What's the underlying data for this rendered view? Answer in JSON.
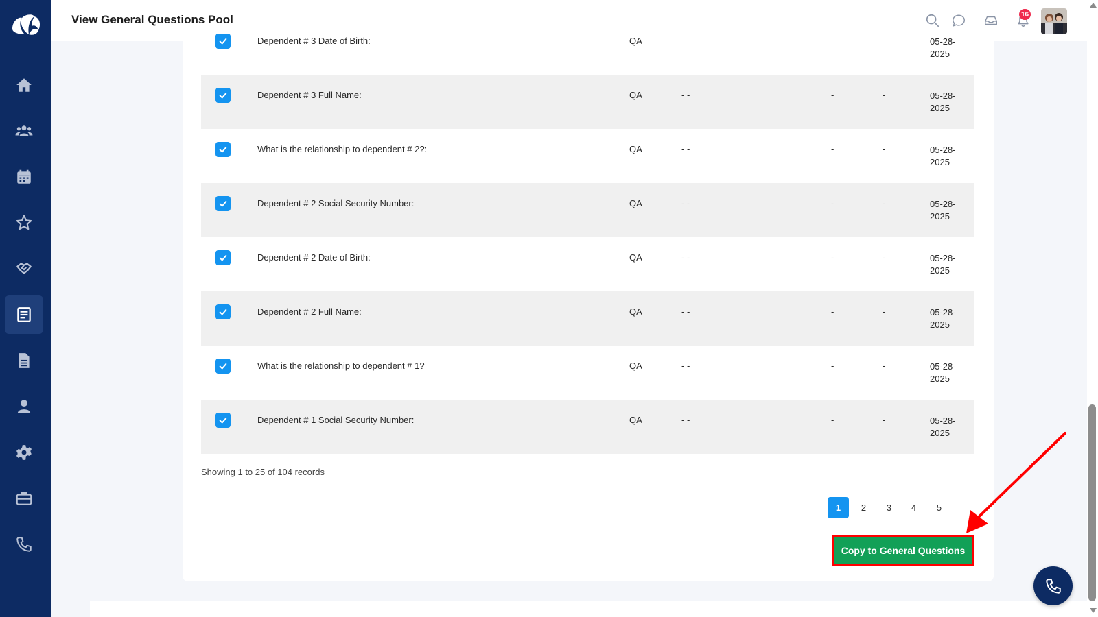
{
  "header": {
    "title": "View General Questions Pool",
    "notification_count": "16"
  },
  "sidebar": {
    "items": [
      {
        "icon": "home-icon"
      },
      {
        "icon": "users-icon"
      },
      {
        "icon": "calendar-icon"
      },
      {
        "icon": "star-icon"
      },
      {
        "icon": "handshake-icon"
      },
      {
        "icon": "questions-icon",
        "active": true
      },
      {
        "icon": "document-icon"
      },
      {
        "icon": "user-icon"
      },
      {
        "icon": "gear-icon"
      },
      {
        "icon": "briefcase-icon"
      },
      {
        "icon": "phone-icon"
      }
    ]
  },
  "table": {
    "partial_row": {
      "question": "Dependent # 3 Date of Birth:",
      "type": "QA",
      "date_line1": "05-28-",
      "date_line2": "2025"
    },
    "rows": [
      {
        "question": "Dependent # 3 Full Name:",
        "type": "QA",
        "options": "- -",
        "col_a": "-",
        "col_b": "-",
        "date_line1": "05-28-",
        "date_line2": "2025"
      },
      {
        "question": "What is the relationship to dependent # 2?:",
        "type": "QA",
        "options": "- -",
        "col_a": "-",
        "col_b": "-",
        "date_line1": "05-28-",
        "date_line2": "2025"
      },
      {
        "question": "Dependent # 2 Social Security Number:",
        "type": "QA",
        "options": "- -",
        "col_a": "-",
        "col_b": "-",
        "date_line1": "05-28-",
        "date_line2": "2025"
      },
      {
        "question": "Dependent # 2 Date of Birth:",
        "type": "QA",
        "options": "- -",
        "col_a": "-",
        "col_b": "-",
        "date_line1": "05-28-",
        "date_line2": "2025"
      },
      {
        "question": "Dependent # 2 Full Name:",
        "type": "QA",
        "options": "- -",
        "col_a": "-",
        "col_b": "-",
        "date_line1": "05-28-",
        "date_line2": "2025"
      },
      {
        "question": "What is the relationship to dependent # 1?",
        "type": "QA",
        "options": "- -",
        "col_a": "-",
        "col_b": "-",
        "date_line1": "05-28-",
        "date_line2": "2025"
      },
      {
        "question": "Dependent # 1 Social Security Number:",
        "type": "QA",
        "options": "- -",
        "col_a": "-",
        "col_b": "-",
        "date_line1": "05-28-",
        "date_line2": "2025"
      }
    ]
  },
  "records_info": "Showing 1 to 25 of 104 records",
  "pagination": {
    "pages": [
      "1",
      "2",
      "3",
      "4",
      "5"
    ],
    "current": "1"
  },
  "copy_button_label": "Copy to General Questions",
  "colors": {
    "sidebar": "#0d2b63",
    "accent": "#1494f0",
    "copy_button": "#12a057",
    "highlight": "#ff0000",
    "badge": "#ef2b4e"
  }
}
